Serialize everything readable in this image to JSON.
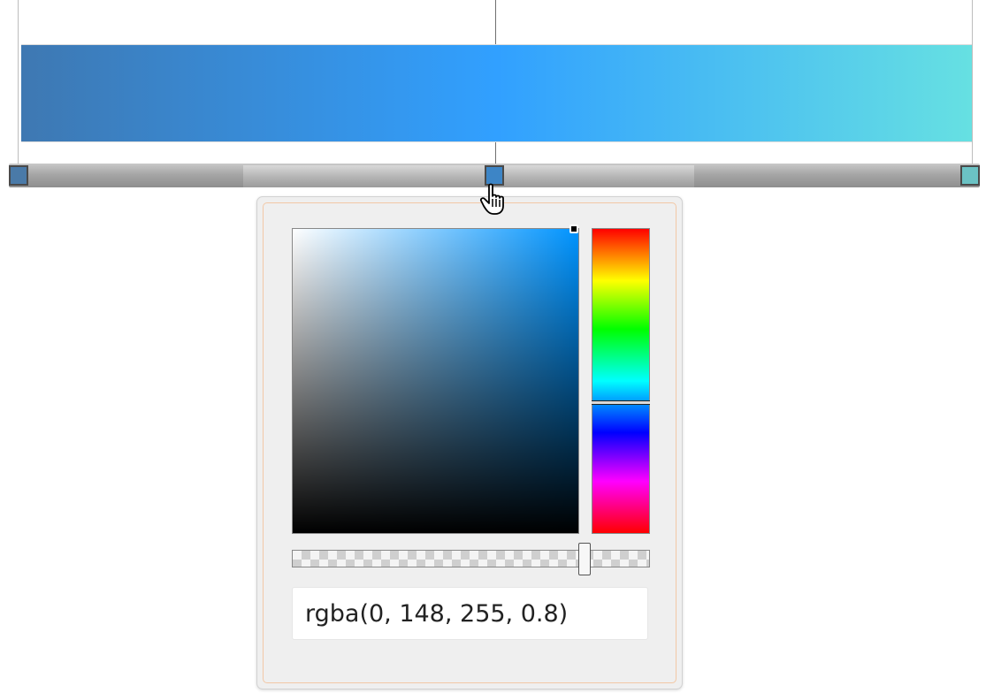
{
  "gradient": {
    "colors": [
      "#3e78b2",
      "#31a0ff",
      "#66e0e2"
    ],
    "stops": [
      {
        "color": "#4a7aa8",
        "position": 0.0
      },
      {
        "color": "#3d85c6",
        "position": 0.5
      },
      {
        "color": "#6bc2c4",
        "position": 1.0
      }
    ],
    "selected_stop": 1
  },
  "color_picker": {
    "value": "rgba(0, 148, 255, 0.8)",
    "hue_color": "#0094ff",
    "hue_level": 0.57,
    "saturation_level": 1.0,
    "brightness_level": 1.0,
    "alpha_level": 0.8
  }
}
